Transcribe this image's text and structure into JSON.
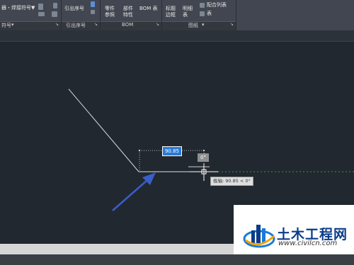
{
  "ribbon": {
    "row1_left": "器・焊接符号▼",
    "leader_number": "引出序号",
    "part_ref": [
      "零件",
      "参照"
    ],
    "part_prop": [
      "部件",
      "特性"
    ],
    "bom_table": "BOM 表",
    "title_frame": [
      "标题",
      "边框"
    ],
    "detail_table": [
      "明细",
      "表"
    ],
    "fit_list": "配合列表",
    "table": "表",
    "groups": {
      "symbol": "符号",
      "leader": "引出序号",
      "bom": "BOM",
      "drawing": "图纸"
    }
  },
  "canvas": {
    "length_value": "90.85",
    "angle_value": "0°",
    "polar_tooltip": "极轴: 90.85 < 0°"
  },
  "watermark": {
    "title": "土木工程网",
    "url": "www.civilcn.com"
  },
  "colors": {
    "canvas_bg": "#212830",
    "ribbon_bg": "#414650",
    "input_highlight": "#2a7ad6",
    "arrow": "#3a5ec8",
    "brand_blue": "#0b3c8a"
  }
}
